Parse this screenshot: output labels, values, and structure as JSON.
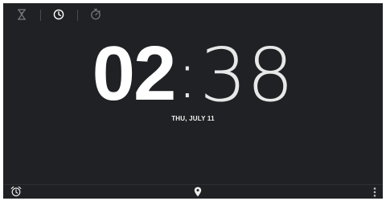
{
  "tabs": [
    {
      "id": "timer",
      "icon": "hourglass-icon",
      "active": false
    },
    {
      "id": "clock",
      "icon": "clock-icon",
      "active": true
    },
    {
      "id": "stopwatch",
      "icon": "stopwatch-icon",
      "active": false
    }
  ],
  "clock": {
    "hours": "02",
    "separator": ":",
    "minutes": "38",
    "date": "THU, JULY 11"
  },
  "bottom_bar": {
    "alarm_icon": "alarm-clock-icon",
    "location_icon": "location-pin-icon",
    "menu_icon": "overflow-menu-icon"
  },
  "colors": {
    "background": "#202124",
    "text": "#ffffff",
    "icon_inactive": "#7a7b7f",
    "icon_active": "#ffffff"
  }
}
